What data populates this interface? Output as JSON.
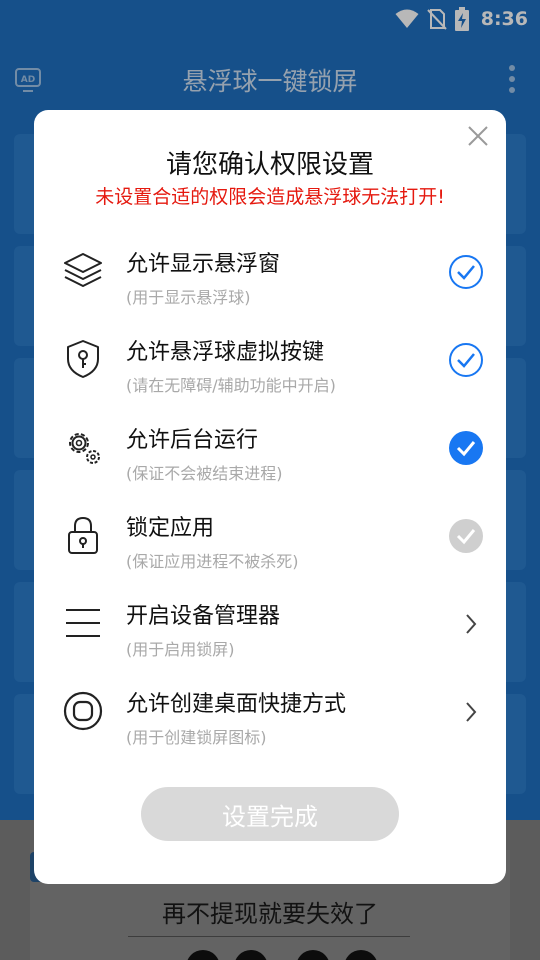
{
  "status_bar": {
    "time": "8:36",
    "icons": [
      "wifi-icon",
      "no-sim-icon",
      "battery-charging-icon"
    ]
  },
  "app_bar": {
    "title": "悬浮球一键锁屏",
    "left_icon": "ad-tv-icon",
    "right_icon": "more-vert-icon"
  },
  "background": {
    "hint": "再不提现就要失效了"
  },
  "dialog": {
    "title": "请您确认权限设置",
    "warning": "未设置合适的权限会造成悬浮球无法打开!",
    "items": [
      {
        "icon": "layers-icon",
        "label": "允许显示悬浮窗",
        "sub": "(用于显示悬浮球)",
        "status": "outline-check"
      },
      {
        "icon": "shield-key-icon",
        "label": "允许悬浮球虚拟按键",
        "sub": "(请在无障碍/辅助功能中开启)",
        "status": "outline-check"
      },
      {
        "icon": "gears-icon",
        "label": "允许后台运行",
        "sub": "(保证不会被结束进程)",
        "status": "filled-check"
      },
      {
        "icon": "lock-icon",
        "label": "锁定应用",
        "sub": "(保证应用进程不被杀死)",
        "status": "grey-check"
      },
      {
        "icon": "menu-lines-icon",
        "label": "开启设备管理器",
        "sub": "(用于启用锁屏)",
        "status": "chevron"
      },
      {
        "icon": "shortcut-circle-icon",
        "label": "允许创建桌面快捷方式",
        "sub": "(用于创建锁屏图标)",
        "status": "chevron"
      }
    ],
    "done_label": "设置完成"
  },
  "colors": {
    "primary": "#1f6fbf",
    "check_blue": "#1877f2",
    "warning_red": "#e5190f",
    "disabled_grey": "#d9d9d9"
  }
}
